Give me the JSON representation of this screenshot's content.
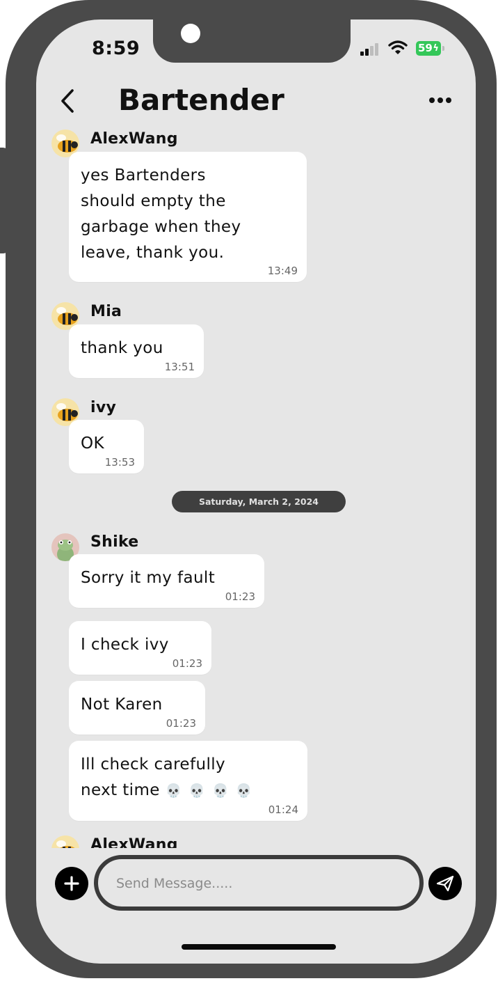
{
  "status_bar": {
    "time": "8:59",
    "battery": "59"
  },
  "header": {
    "title": "Bartender"
  },
  "messages": [
    {
      "sender": "AlexWang",
      "lines": [
        "yes Bartenders",
        "should empty the",
        "garbage when they",
        "leave, thank you."
      ],
      "time": "13:49"
    },
    {
      "sender": "Mia",
      "lines": [
        "thank you"
      ],
      "time": "13:51"
    },
    {
      "sender": "ivy",
      "lines": [
        "OK"
      ],
      "time": "13:53"
    },
    {
      "sender": "Shike",
      "lines": [
        "Sorry it my fault"
      ],
      "time": "01:23"
    },
    {
      "lines": [
        "I check ivy"
      ],
      "time": "01:23"
    },
    {
      "lines": [
        "Not Karen"
      ],
      "time": "01:23"
    },
    {
      "lines": [
        "Ill check carefully",
        "next time"
      ],
      "emoji": "💀 💀 💀 💀",
      "time": "01:24"
    },
    {
      "sender": "AlexWang"
    }
  ],
  "date_divider": "Saturday, March 2, 2024",
  "composer": {
    "placeholder": "Send Message....."
  },
  "icons": {
    "back": "chevron-left-icon",
    "more": "ellipsis-icon",
    "add": "plus-icon",
    "send": "paper-plane-icon"
  },
  "colors": {
    "frame": "#4a4a4a",
    "screen_bg": "#e6e6e6",
    "bubble": "#ffffff",
    "battery": "#34c759",
    "date_pill": "#3f3f3f"
  }
}
